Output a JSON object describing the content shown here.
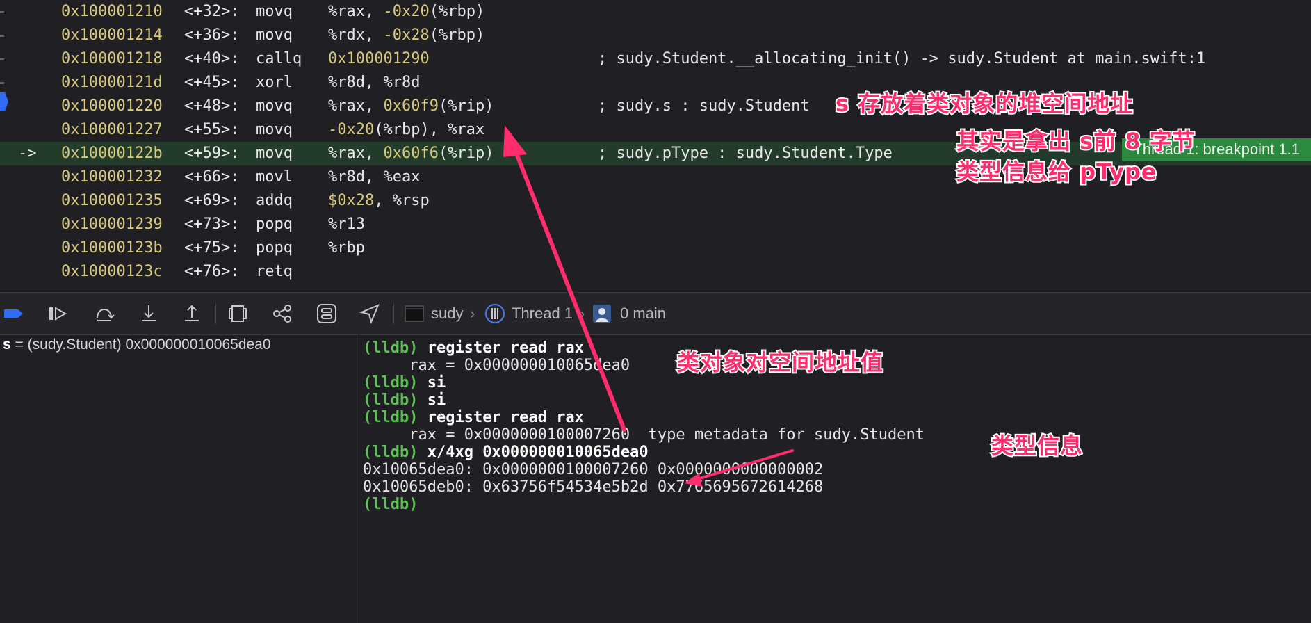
{
  "disassembly": {
    "rows": [
      {
        "arrow": "",
        "addr": "0x100001210",
        "offset": "<+32>:",
        "mnemonic": "movq",
        "operands": "%rax, -0x20(%rbp)",
        "comment": ""
      },
      {
        "arrow": "",
        "addr": "0x100001214",
        "offset": "<+36>:",
        "mnemonic": "movq",
        "operands": "%rdx, -0x28(%rbp)",
        "comment": ""
      },
      {
        "arrow": "",
        "addr": "0x100001218",
        "offset": "<+40>:",
        "mnemonic": "callq",
        "operands": "0x100001290",
        "comment": "; sudy.Student.__allocating_init() -> sudy.Student at main.swift:1"
      },
      {
        "arrow": "",
        "addr": "0x10000121d",
        "offset": "<+45>:",
        "mnemonic": "xorl",
        "operands": "%r8d, %r8d",
        "comment": ""
      },
      {
        "arrow": "",
        "addr": "0x100001220",
        "offset": "<+48>:",
        "mnemonic": "movq",
        "operands": "%rax, 0x60f9(%rip)",
        "comment": "; sudy.s : sudy.Student"
      },
      {
        "arrow": "",
        "addr": "0x100001227",
        "offset": "<+55>:",
        "mnemonic": "movq",
        "operands": "-0x20(%rbp), %rax",
        "comment": ""
      },
      {
        "arrow": "->",
        "addr": "0x10000122b",
        "offset": "<+59>:",
        "mnemonic": "movq",
        "operands": "%rax, 0x60f6(%rip)",
        "comment": "; sudy.pType : sudy.Student.Type"
      },
      {
        "arrow": "",
        "addr": "0x100001232",
        "offset": "<+66>:",
        "mnemonic": "movl",
        "operands": "%r8d, %eax",
        "comment": ""
      },
      {
        "arrow": "",
        "addr": "0x100001235",
        "offset": "<+69>:",
        "mnemonic": "addq",
        "operands": "$0x28, %rsp",
        "comment": ""
      },
      {
        "arrow": "",
        "addr": "0x100001239",
        "offset": "<+73>:",
        "mnemonic": "popq",
        "operands": "%r13",
        "comment": ""
      },
      {
        "arrow": "",
        "addr": "0x10000123b",
        "offset": "<+75>:",
        "mnemonic": "popq",
        "operands": "%rbp",
        "comment": ""
      },
      {
        "arrow": "",
        "addr": "0x10000123c",
        "offset": "<+76>:",
        "mnemonic": "retq",
        "operands": "",
        "comment": ""
      }
    ],
    "current_row": 6,
    "breakpoint_label": "Thread 1: breakpoint 1.1"
  },
  "debug_bar": {
    "icons": [
      "breakpoint-toggle-icon",
      "continue-icon",
      "step-over-icon",
      "step-into-icon",
      "step-out-icon",
      "view-hierarchy-icon",
      "memory-graph-icon",
      "environment-overrides-icon",
      "location-icon"
    ],
    "breadcrumb": {
      "target": "sudy",
      "thread": "Thread 1",
      "frame": "0 main"
    }
  },
  "variables": {
    "name": "s",
    "rest": " = (sudy.Student) 0x000000010065dea0"
  },
  "console": {
    "lines": [
      {
        "prompt": "(lldb) ",
        "cmd": "register read rax",
        "out": ""
      },
      {
        "prompt": "",
        "cmd": "",
        "out": "     rax = 0x000000010065dea0"
      },
      {
        "prompt": "(lldb) ",
        "cmd": "si",
        "out": ""
      },
      {
        "prompt": "(lldb) ",
        "cmd": "si",
        "out": ""
      },
      {
        "prompt": "(lldb) ",
        "cmd": "register read rax",
        "out": ""
      },
      {
        "prompt": "",
        "cmd": "",
        "out": "     rax = 0x0000000100007260  type metadata for sudy.Student"
      },
      {
        "prompt": "(lldb) ",
        "cmd": "x/4xg 0x000000010065dea0",
        "out": ""
      },
      {
        "prompt": "",
        "cmd": "",
        "out": "0x10065dea0: 0x0000000100007260 0x0000000000000002"
      },
      {
        "prompt": "",
        "cmd": "",
        "out": "0x10065deb0: 0x63756f54534e5b2d 0x7765695672614268"
      },
      {
        "prompt": "(lldb)",
        "cmd": "",
        "out": ""
      }
    ]
  },
  "annotations": {
    "s_heap": "s 存放着类对象的堆空间地址",
    "take_first8_line1": "其实是拿出 s前 8 字节",
    "take_first8_line2": "类型信息给 pType",
    "heap_addr_value": "类对象对空间地址值",
    "type_info": "类型信息"
  },
  "colors": {
    "annotation": "#ff2d6d",
    "prompt": "#5fbf57",
    "address": "#d8c87a",
    "current_line": "#223b2a",
    "breakpoint_badge": "#2b8a3e"
  }
}
